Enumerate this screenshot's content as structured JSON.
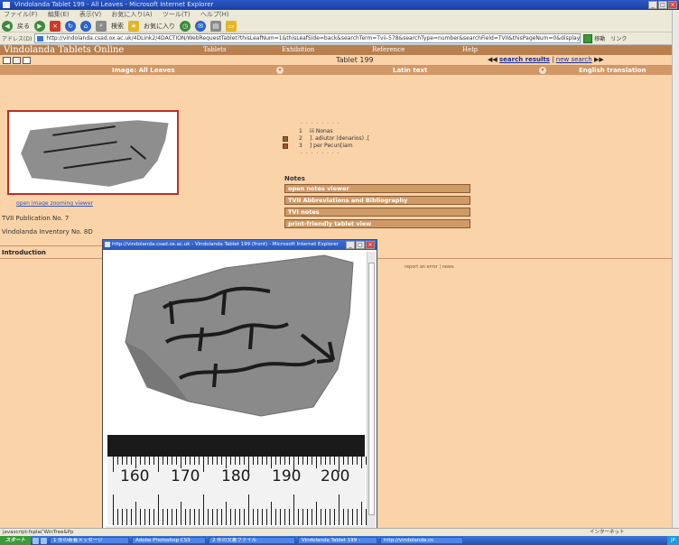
{
  "browser": {
    "title": "Vindolanda Tablet 199 - All Leaves - Microsoft Internet Explorer",
    "menu": [
      "ファイル(F)",
      "編集(E)",
      "表示(V)",
      "お気に入り(A)",
      "ツール(T)",
      "ヘルプ(H)"
    ],
    "toolbar": {
      "back": "戻る",
      "search": "検索",
      "favorites": "お気に入り"
    },
    "address_label": "アドレス(D)",
    "url": "http://vindolanda.csad.ox.ac.uk/4DLink2/4DACTION/WebRequestTablet?thisLeafNum=1&thisLeafSide=back&searchTerm=Tvii-578&searchType=number&searchField=TVII&thisPageNum=0&display=...",
    "go": "移動",
    "links": "リンク"
  },
  "site": {
    "logo": "Vindolanda Tablets Online",
    "nav": [
      "Tablets",
      "Exhibition",
      "Reference",
      "Help"
    ]
  },
  "panel": {
    "tablet_label": "Tablet 199",
    "search_results": "search results",
    "new_search": "new search",
    "separator": "|"
  },
  "columns": {
    "image": "Image: All Leaves",
    "latin": "Latin text",
    "english": "English translation"
  },
  "left": {
    "open_zoom": "open image zooming viewer",
    "publication": "TVII Publication No. 7",
    "inventory": "Vindolanda Inventory No. 8D",
    "introduction": "Introduction"
  },
  "latin": {
    "dots": "· · · · · · · ·",
    "lines": [
      {
        "num": "1",
        "text": "iii Nonas"
      },
      {
        "num": "2",
        "text": "]. adiutor (denarios) .["
      },
      {
        "num": "3",
        "text": "] per Pecun[iam"
      }
    ]
  },
  "notes": {
    "heading": "Notes",
    "buttons": [
      "open notes viewer",
      "TVII Abbreviations and Bibliography",
      "TVI notes",
      "print-friendly tablet view"
    ]
  },
  "report_text": "report an error | news",
  "popup": {
    "title": "http://vindolanda.csad.ox.ac.uk - Vindolanda Tablet 199 (front) - Microsoft Internet Explorer",
    "ruler_numbers": [
      "160",
      "170",
      "180",
      "190",
      "200"
    ]
  },
  "statusbar": {
    "text": "javascript:fspla('WinTree&Pp",
    "zone": "インターネット"
  },
  "taskbar": {
    "start": "スタート",
    "tasks": [
      "1 件の新着メッセージ",
      "Adobe Photoshop CS3",
      "2 件の文書ファイル",
      "Vindolanda Tablet 199 -",
      "http://vindolanda.cs"
    ],
    "tray": "JP"
  },
  "colors": {
    "accent": "#b8804f",
    "panel": "#fad3a8",
    "header": "#d39868",
    "link": "#1a2f9e"
  }
}
